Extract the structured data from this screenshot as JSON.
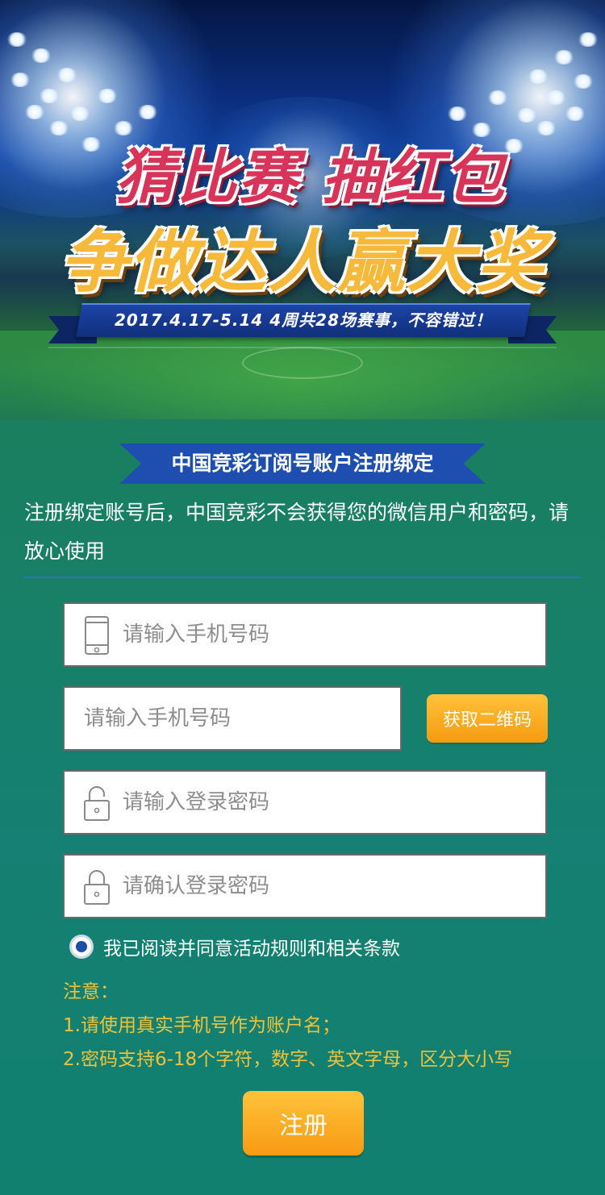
{
  "hero": {
    "title_line1": "猜比赛 抽红包",
    "title_line2": "争做达人赢大奖",
    "date_text": "2017.4.17-5.14  4周共28场赛事，不容错过！"
  },
  "section": {
    "title": "中国竞彩订阅号账户注册绑定",
    "notice": "注册绑定账号后，中国竞彩不会获得您的微信用户和密码，请放心使用"
  },
  "form": {
    "phone_placeholder": "请输入手机号码",
    "code_placeholder": "请输入手机号码",
    "get_code_label": "获取二维码",
    "password_placeholder": "请输入登录密码",
    "confirm_placeholder": "请确认登录密码",
    "agree_label": "我已阅读并同意活动规则和相关条款",
    "agree_checked": true,
    "submit_label": "注册"
  },
  "notes": {
    "heading": "注意：",
    "items": [
      "1.请使用真实手机号作为账户名；",
      "2.密码支持6-18个字符，数字、英文字母，区分大小写"
    ]
  },
  "colors": {
    "accent_orange": "#f6a520",
    "banner_blue": "#1e4fb0",
    "note_yellow": "#f0c23a",
    "bg_green": "#158073"
  },
  "icons": {
    "phone": "phone-icon",
    "lock": "lock-icon"
  }
}
